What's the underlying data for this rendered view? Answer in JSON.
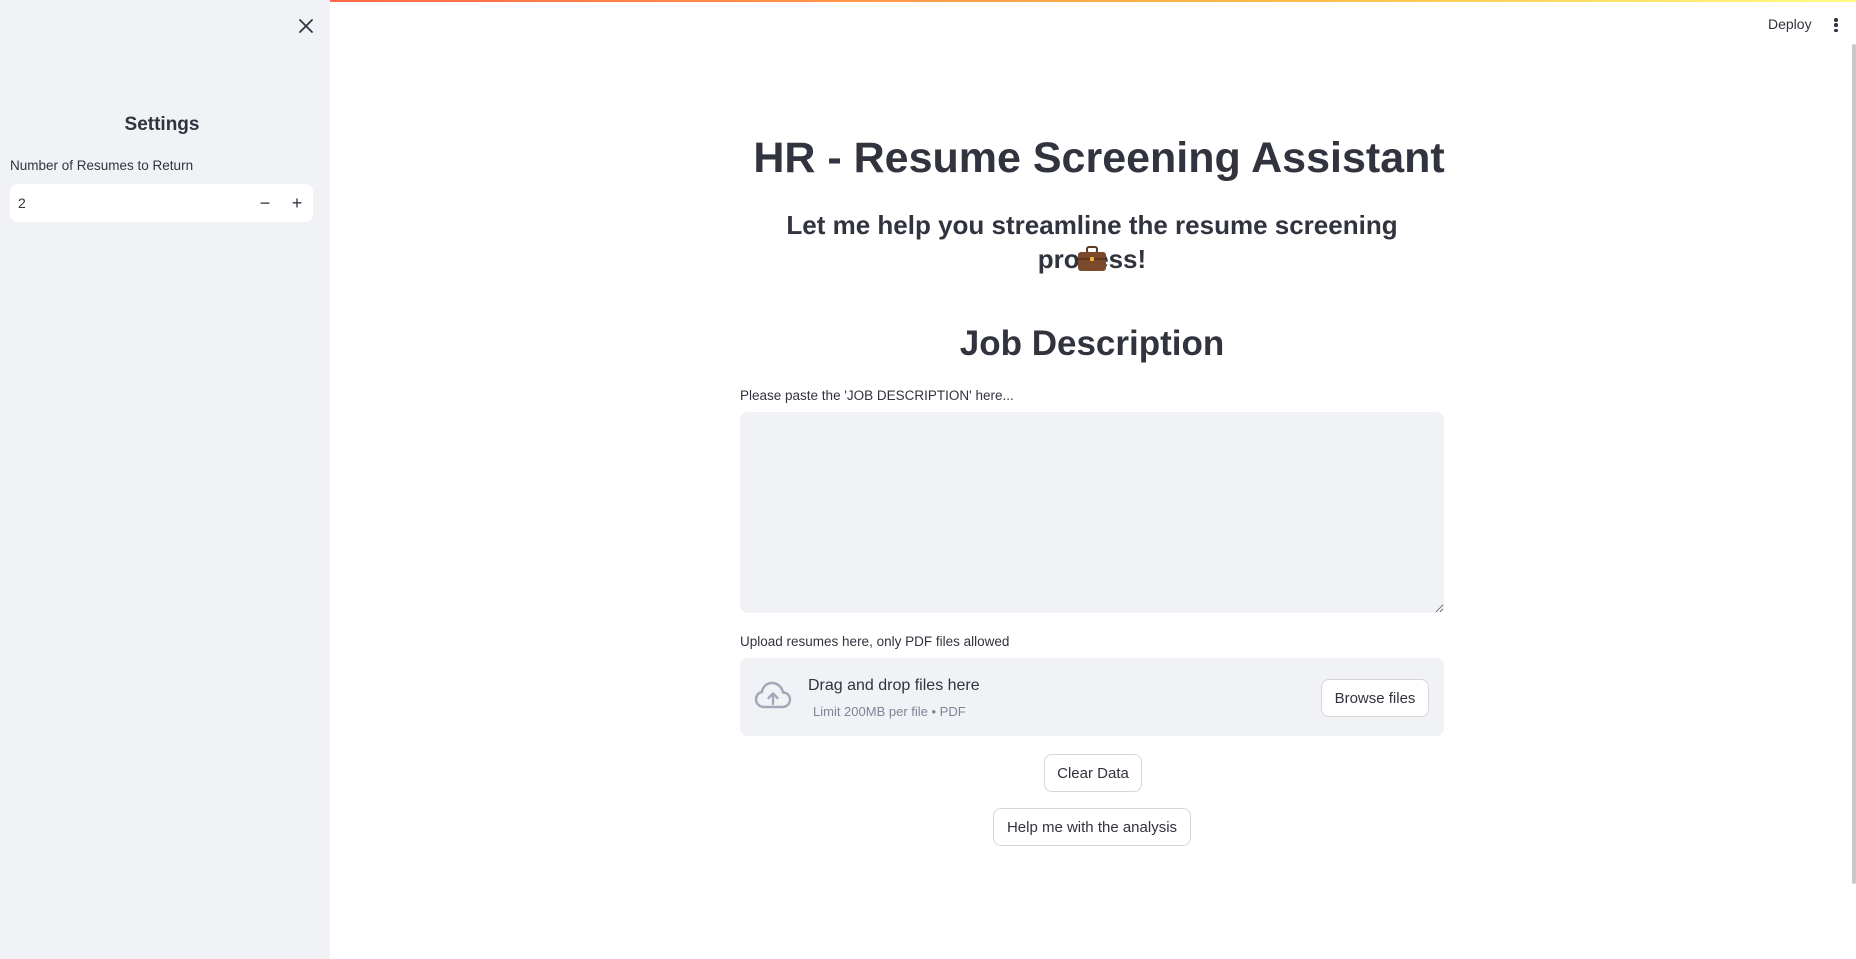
{
  "sidebar": {
    "title": "Settings",
    "resume_count_label": "Number of Resumes to Return",
    "resume_count_value": "2",
    "decrement_symbol": "−",
    "increment_symbol": "+"
  },
  "header": {
    "deploy_label": "Deploy"
  },
  "main": {
    "title": "HR - Resume Screening Assistant",
    "title_icon": "clipboard-icon",
    "subtitle": "Let me help you streamline the resume screening process!",
    "subtitle_icon": "briefcase-icon",
    "section_title": "Job Description",
    "jd_label": "Please paste the 'JOB DESCRIPTION' here...",
    "jd_value": "",
    "upload_label": "Upload resumes here, only PDF files allowed",
    "dropzone_title": "Drag and drop files here",
    "dropzone_subtitle": "Limit 200MB per file • PDF",
    "browse_label": "Browse files",
    "clear_label": "Clear Data",
    "analyze_label": "Help me with the analysis"
  },
  "colors": {
    "accent_gradient_start": "#ff4b4b",
    "accent_gradient_end": "#fffd80",
    "sidebar_bg": "#f0f2f6",
    "text": "#31333f"
  }
}
